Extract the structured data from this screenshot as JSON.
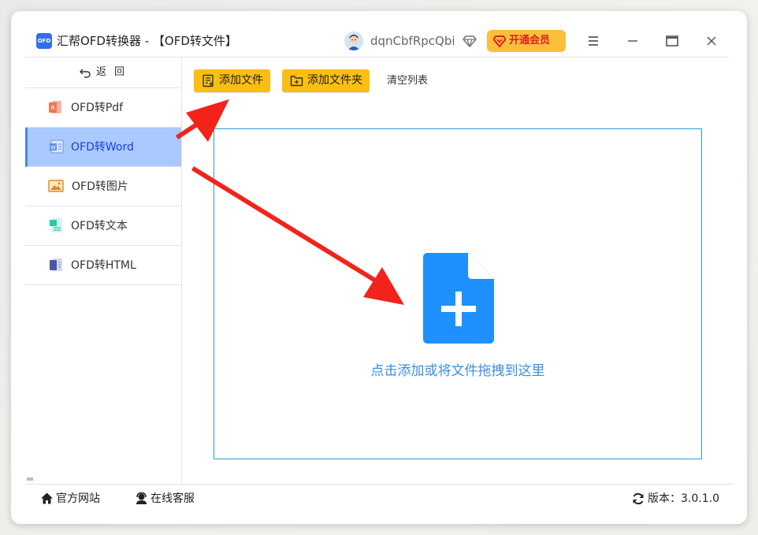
{
  "app": {
    "logo_text": "OFD",
    "title": "汇帮OFD转换器 - 【OFD转文件】"
  },
  "user": {
    "name": "dqnCbfRpcQbi",
    "vip_label": "开通会员"
  },
  "sidebar": {
    "back_label": "返回",
    "items": [
      {
        "label": "OFD转Pdf",
        "icon": "pdf-icon",
        "active": false
      },
      {
        "label": "OFD转Word",
        "icon": "word-icon",
        "active": true
      },
      {
        "label": "OFD转图片",
        "icon": "image-icon",
        "active": false
      },
      {
        "label": "OFD转文本",
        "icon": "text-icon",
        "active": false
      },
      {
        "label": "OFD转HTML",
        "icon": "html-icon",
        "active": false
      }
    ]
  },
  "toolbar": {
    "add_file": "添加文件",
    "add_folder": "添加文件夹",
    "clear_list": "清空列表"
  },
  "drop_zone": {
    "hint": "点击添加或将文件拖拽到这里"
  },
  "status": {
    "website": "官方网站",
    "service": "在线客服",
    "version": "版本：3.0.1.0"
  },
  "colors": {
    "accent_yellow": "#fbbf13",
    "active_nav": "#a9c9ff",
    "drop_border": "#2a9bd6",
    "drop_icon": "#1e90ff",
    "arrow_red": "#f2231a"
  }
}
